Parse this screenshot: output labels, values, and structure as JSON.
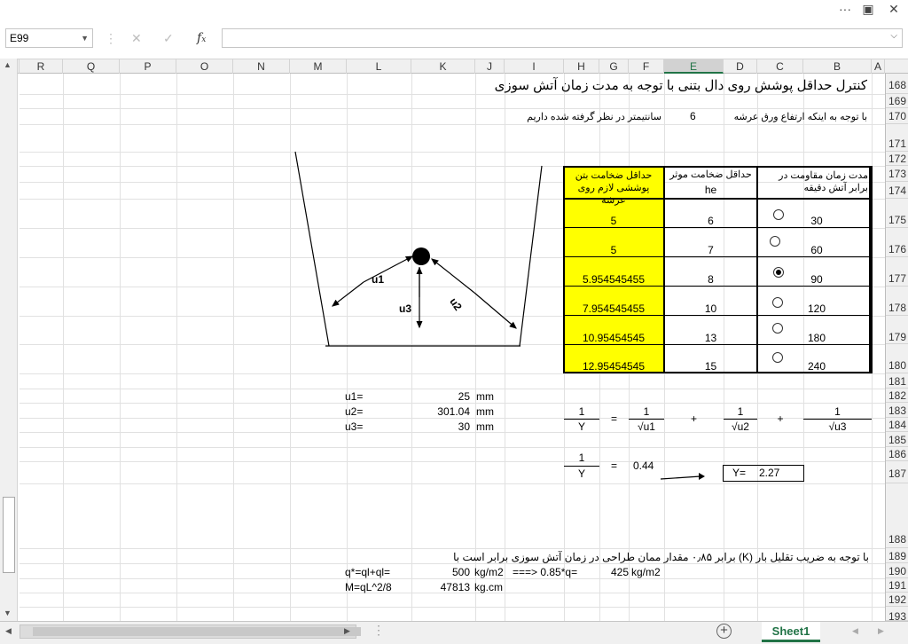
{
  "window": {
    "controls": [
      "···",
      "□",
      "–",
      "□",
      "✕"
    ]
  },
  "formula_bar": {
    "name_box": "E99",
    "formula": "",
    "icons": [
      "more-icon",
      "cancel-icon",
      "enter-icon",
      "function-icon"
    ]
  },
  "columns": [
    "R",
    "Q",
    "P",
    "O",
    "N",
    "M",
    "L",
    "K",
    "J",
    "I",
    "H",
    "G",
    "F",
    "E",
    "D",
    "C",
    "B",
    "A"
  ],
  "selected_column": "E",
  "rows": [
    "168",
    "169",
    "170",
    "171",
    "172",
    "173",
    "174",
    "175",
    "176",
    "177",
    "178",
    "179",
    "180",
    "181",
    "182",
    "183",
    "184",
    "185",
    "186",
    "187",
    "188",
    "189",
    "190",
    "191",
    "192",
    "193"
  ],
  "sheet": {
    "title": "کنترل حداقل پوشش روی دال بتنی با توجه به مدت زمان آتش سوزی",
    "row170_label": "با توجه به اینکه ارتفاع ورق عرشه",
    "row170_value": "6",
    "row170_suffix": "سانتیمتر در نظر گرفته شده داریم",
    "table": {
      "headers": {
        "col_b": "مدت زمان مقاومت در برابر آتش دقیقه",
        "col_e": "حداقل ضخامت موثر",
        "col_e_sub": "he",
        "col_h": "حداقل ضخامت بتن پوششی لازم روی عرشه"
      },
      "rows": [
        {
          "minutes": "30",
          "he": "6",
          "cover": "5",
          "selected": false
        },
        {
          "minutes": "60",
          "he": "7",
          "cover": "5",
          "selected": false
        },
        {
          "minutes": "90",
          "he": "8",
          "cover": "5.954545455",
          "selected": true
        },
        {
          "minutes": "120",
          "he": "10",
          "cover": "7.954545455",
          "selected": false
        },
        {
          "minutes": "180",
          "he": "13",
          "cover": "10.95454545",
          "selected": false
        },
        {
          "minutes": "240",
          "he": "15",
          "cover": "12.95454545",
          "selected": false
        }
      ]
    },
    "diagram_labels": {
      "u1": "u1",
      "u2": "u2",
      "u3": "u3"
    },
    "values": [
      {
        "label": "u1=",
        "value": "25",
        "unit": "mm"
      },
      {
        "label": "u2=",
        "value": "301.04",
        "unit": "mm"
      },
      {
        "label": "u3=",
        "value": "30",
        "unit": "mm"
      }
    ],
    "formula": {
      "one": "1",
      "Y": "Y",
      "eq": "=",
      "plus": "+",
      "su1": "√u1",
      "su2": "√u2",
      "su3": "√u3",
      "result": "0.44",
      "y_label": "Y=",
      "y_value": "2.27"
    },
    "row189_note": "با توجه به ضریب تقلیل بار (K) برابر ۰٫۸۵ مقدار ممان طراحی در زمان آتش سوزی برابر است با",
    "row190": {
      "label": "q*=ql+ql=",
      "value": "500",
      "unit": "kg/m2",
      "arrow": "===> 0.85*q=",
      "result": "425",
      "result_unit": "kg/m2"
    },
    "row191": {
      "label": "M=qL^2/8",
      "value": "47813",
      "unit": "kg.cm"
    }
  },
  "tabs": {
    "active": "Sheet1"
  }
}
